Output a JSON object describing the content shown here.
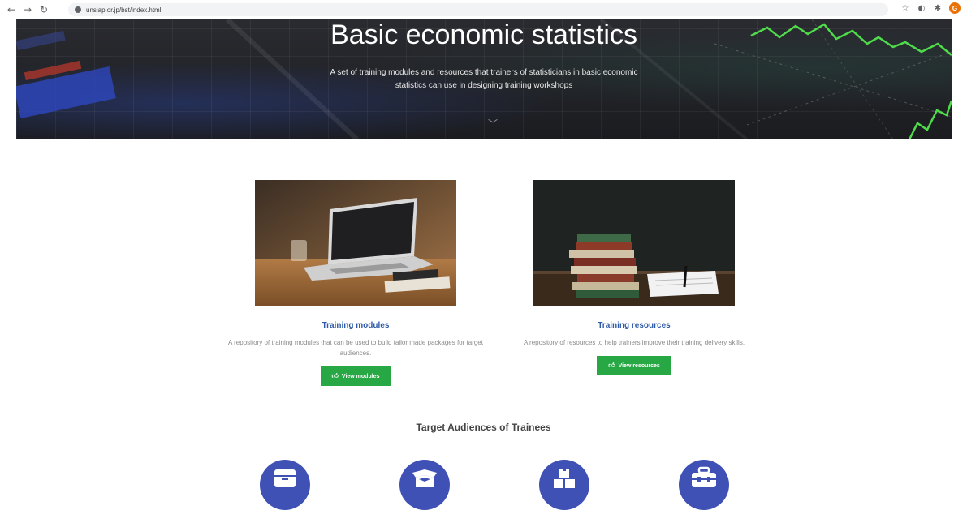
{
  "browser": {
    "url": "unsiap.or.jp/bst/index.html",
    "profile_initial": "G",
    "back_icon": "arrow-left-icon",
    "forward_icon": "arrow-right-icon",
    "reload_icon": "reload-icon"
  },
  "hero": {
    "title": "Basic economic statistics",
    "subtitle": "A set of training modules and resources that trainers of statisticians in basic economic statistics can use in designing training workshops"
  },
  "cards": [
    {
      "title": "Training modules",
      "description": "A repository of training modules that can be used to build tailor made packages for target audiences.",
      "button_label": "View modules",
      "button_icon": "thumbs-up-icon"
    },
    {
      "title": "Training resources",
      "description": "A repository of resources to help trainers improve their training delivery skills.",
      "button_label": "View resources",
      "button_icon": "thumbs-up-icon"
    }
  ],
  "audiences": {
    "heading": "Target Audiences of Trainees",
    "icons": [
      "box-icon",
      "open-box-icon",
      "boxes-stack-icon",
      "toolbox-icon"
    ]
  },
  "colors": {
    "accent_green": "#28a745",
    "accent_blue": "#3f51b5",
    "title_blue": "#2f5aa8"
  }
}
